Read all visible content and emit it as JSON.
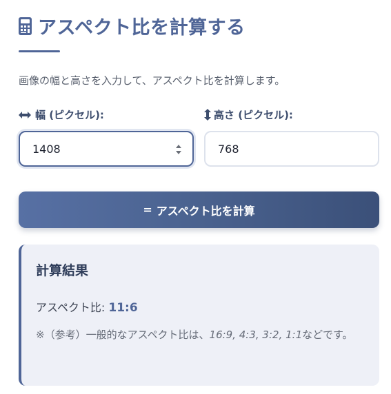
{
  "header": {
    "title": "アスペクト比を計算する",
    "description": "画像の幅と高さを入力して、アスペクト比を計算します。"
  },
  "fields": {
    "width_label": "幅 (ピクセル):",
    "width_value": "1408",
    "height_label": "高さ (ピクセル):",
    "height_value": "768"
  },
  "button": {
    "icon": "=",
    "label": "アスペクト比を計算"
  },
  "result": {
    "title": "計算結果",
    "ratio_label": "アスペクト比:",
    "ratio_value": "11:6",
    "note_prefix": "※（参考）一般的なアスペクト比は、",
    "note_examples": "16:9, 4:3, 3:2, 1:1",
    "note_suffix": "などです。"
  },
  "icons": {
    "title_icon": "calculator-icon",
    "width_icon": "arrows-horizontal-icon",
    "height_icon": "arrows-vertical-icon",
    "spinner_icon": "number-spinner-icon"
  },
  "colors": {
    "accent": "#4f6597",
    "result_bg": "#eef0f7"
  }
}
